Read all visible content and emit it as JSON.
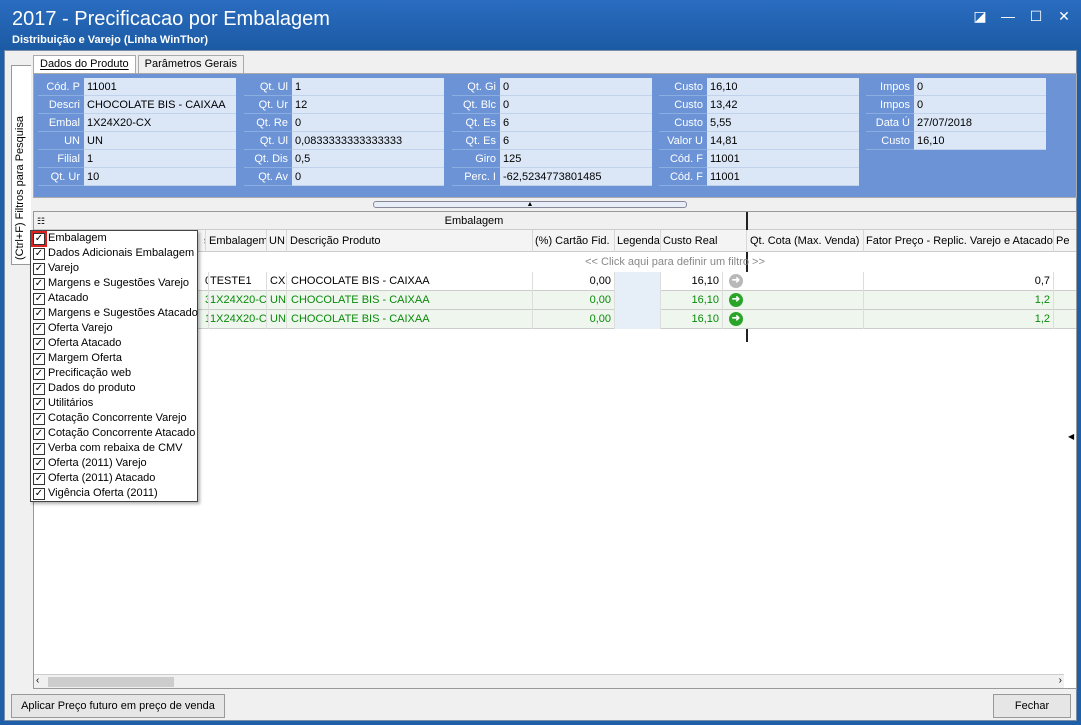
{
  "window": {
    "title": "2017 - Precificacao por Embalagem",
    "subtitle": "Distribuição e Varejo (Linha WinThor)",
    "buttons": [
      "◪",
      "—",
      "☐",
      "✕"
    ]
  },
  "side_tab": "(Ctrl+F) Filtros para Pesquisa",
  "tabs": [
    "Dados do Produto",
    "Parâmetros Gerais"
  ],
  "info": {
    "col1": [
      [
        "Cód. P",
        "11001"
      ],
      [
        "Descri",
        "CHOCOLATE BIS  - CAIXAA"
      ],
      [
        "Embal",
        "1X24X20-CX"
      ],
      [
        "UN",
        "UN"
      ],
      [
        "Filial",
        "1"
      ],
      [
        "Qt. Ur",
        "10"
      ]
    ],
    "col2": [
      [
        "Qt. Ul",
        "1"
      ],
      [
        "Qt. Ur",
        "12"
      ],
      [
        "Qt. Re",
        "0"
      ],
      [
        "Qt. Ul",
        "0,0833333333333333"
      ],
      [
        "Qt. Dis",
        "0,5"
      ],
      [
        "Qt. Av",
        "0"
      ]
    ],
    "col3": [
      [
        "Qt. Gi",
        "0"
      ],
      [
        "Qt. Blc",
        "0"
      ],
      [
        "Qt. Es",
        "6"
      ],
      [
        "Qt. Es",
        "6"
      ],
      [
        "Giro",
        "125"
      ],
      [
        "Perc. I",
        "-62,5234773801485"
      ]
    ],
    "col4": [
      [
        "Custo",
        "16,10"
      ],
      [
        "Custo",
        "13,42"
      ],
      [
        "Custo",
        "5,55"
      ],
      [
        "Valor U",
        "14,81"
      ],
      [
        "Cód. F",
        "11001"
      ],
      [
        "Cód. F",
        "11001"
      ]
    ],
    "col5": [
      [
        "Impos",
        "0"
      ],
      [
        "Impos",
        "0"
      ],
      [
        "Data Ú",
        "27/07/2018"
      ],
      [
        "Custo",
        "16,10"
      ]
    ]
  },
  "grid": {
    "band_label": "Embalagem",
    "headers": [
      "s",
      "Embalagem",
      "UN",
      "Descrição Produto",
      "(%) Cartão Fid.",
      "Legenda",
      "Custo Real",
      "Qt. Cota (Max. Venda)",
      "Fator Preço - Replic. Varejo e Atacado",
      "Pe"
    ],
    "filter_hint": "<< Click aqui para definir um filtro >>",
    "rows": [
      {
        "c0": "0",
        "emb": "TESTE1",
        "un": "CX",
        "desc": "CHOCOLATE BIS  - CAIXAA",
        "cartao": "0,00",
        "custo": "16,10",
        "fator": "0,7",
        "green": false
      },
      {
        "c0": "3",
        "emb": "1X24X20-C",
        "un": "UN",
        "desc": "CHOCOLATE BIS  - CAIXAA",
        "cartao": "0,00",
        "custo": "16,10",
        "fator": "1,2",
        "green": true
      },
      {
        "c0": "1",
        "emb": "1X24X20-C",
        "un": "UN",
        "desc": "CHOCOLATE BIS  - CAIXAA",
        "cartao": "0,00",
        "custo": "16,10",
        "fator": "1,2",
        "green": true
      }
    ]
  },
  "column_chooser": [
    "Embalagem",
    "Dados Adicionais Embalagem",
    "Varejo",
    "Margens e Sugestões Varejo",
    "Atacado",
    "Margens e Sugestões Atacado",
    "Oferta Varejo",
    "Oferta Atacado",
    "Margem Oferta",
    "Precificação web",
    "Dados do produto",
    "Utilitários",
    "Cotação Concorrente Varejo",
    "Cotação Concorrente Atacado",
    "Verba com rebaixa de CMV",
    "Oferta (2011) Varejo",
    "Oferta (2011) Atacado",
    "Vigência Oferta (2011)"
  ],
  "footer": {
    "apply_label": "Aplicar Preço futuro em preço de venda",
    "close_label": "Fechar"
  },
  "colors": {
    "accent": "#1f5fa8",
    "label_bg": "#6b93d6",
    "value_bg": "#dbe7f7",
    "green_text": "#0a8a0a",
    "highlight": "#e02020"
  }
}
